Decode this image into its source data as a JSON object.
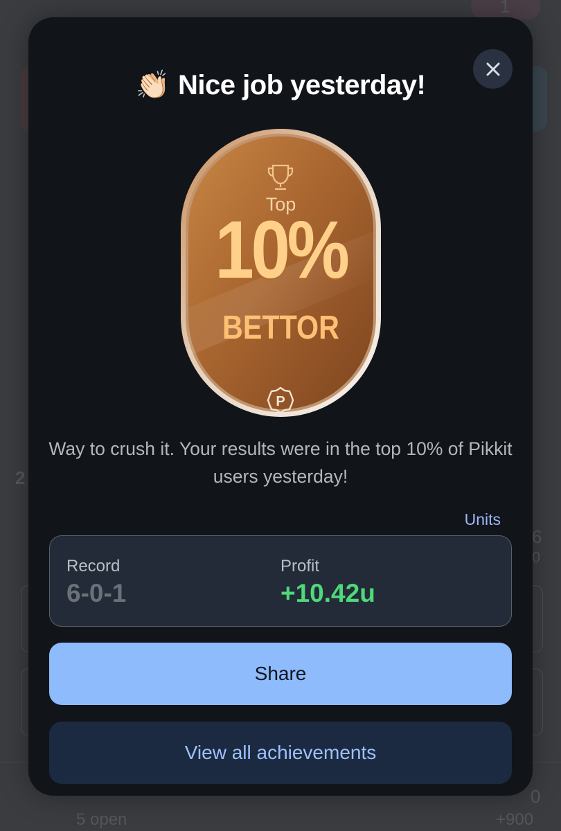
{
  "background": {
    "top_right_number": "1",
    "left_number": "2",
    "right_digit": "6",
    "right_sub": "0",
    "bottom_left": "5 open",
    "bottom_right_top": "0",
    "bottom_right": "+900"
  },
  "modal": {
    "title_emoji": "👏🏻",
    "title": "Nice job yesterday!",
    "close_icon": "close-icon",
    "badge": {
      "top": "Top",
      "percent": "10%",
      "label": "BETTOR",
      "icons": [
        "trophy-icon",
        "pikkit-logo-icon"
      ]
    },
    "description": "Way to crush it. Your results were in the top 10% of Pikkit users yesterday!",
    "units_link": "Units",
    "stats": {
      "record_label": "Record",
      "record_value": "6-0-1",
      "profit_label": "Profit",
      "profit_value": "+10.42u"
    },
    "share_label": "Share",
    "achievements_label": "View all achievements"
  },
  "colors": {
    "modal_bg": "#111419",
    "accent_blue": "#8dbbfb",
    "profit_green": "#4fd97a",
    "badge_bronze": "#a9672f"
  }
}
